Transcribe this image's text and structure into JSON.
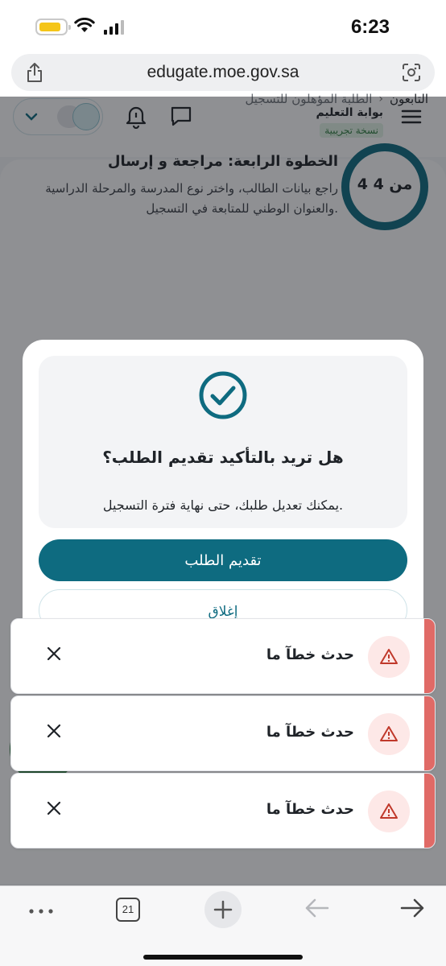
{
  "status": {
    "time": "6:23"
  },
  "browser": {
    "url": "edugate.moe.gov.sa",
    "tab_count": "21"
  },
  "header": {
    "brand_name": "بوابة التعليم",
    "badge": "نسخة تجريبية"
  },
  "breadcrumb": {
    "item1": "التابعون",
    "separator": "›",
    "item2": "الطلبة المؤهلون للتسجيل"
  },
  "step": {
    "progress_text": "4 من 4",
    "title": "الخطوة الرابعة: مراجعة و إرسال",
    "description": "راجع بيانات الطالب، واختر نوع المدرسة والمرحلة الدراسية والعنوان الوطني للمتابعة في التسجيل."
  },
  "modal": {
    "title": "هل تريد بالتأكيد تقديم الطلب؟",
    "text": "يمكنك تعديل طلبك، حتى نهاية فترة التسجيل.",
    "submit_label": "تقديم الطلب",
    "close_label": "إغلاق"
  },
  "toasts": [
    {
      "message": "حدث خطآ ما"
    },
    {
      "message": "حدث خطآ ما"
    },
    {
      "message": "حدث خطآ ما"
    }
  ],
  "colors": {
    "primary": "#0e6b80",
    "error_accent": "#e06a66",
    "badge_green": "#2f7d40"
  }
}
